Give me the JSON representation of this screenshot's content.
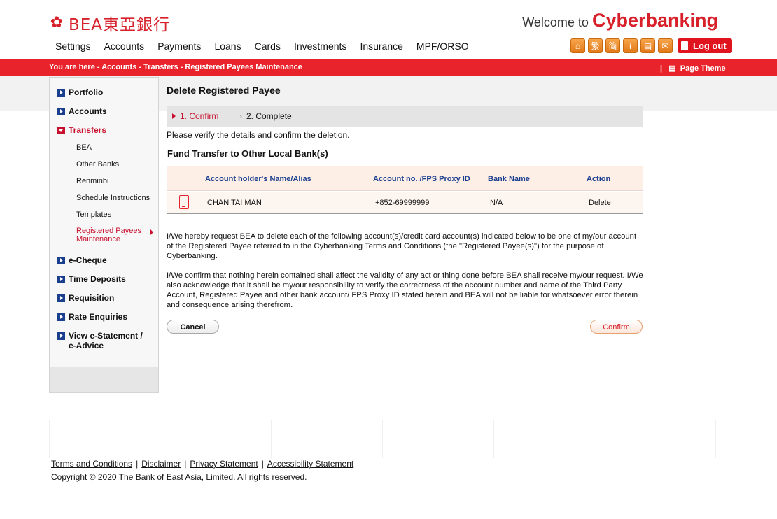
{
  "brand": {
    "logo_text": "BEA東亞銀行",
    "welcome_prefix": "Welcome to",
    "welcome_brand": "Cyberbanking"
  },
  "topnav": [
    "Settings",
    "Accounts",
    "Payments",
    "Loans",
    "Cards",
    "Investments",
    "Insurance",
    "MPF/ORSO"
  ],
  "tools": {
    "icons": [
      "home-icon",
      "traditional-chinese-icon",
      "simplified-chinese-icon",
      "info-icon",
      "print-icon",
      "mail-icon"
    ],
    "glyphs": [
      "⌂",
      "繁",
      "简",
      "i",
      "▤",
      "✉"
    ],
    "logout_label": "Log out"
  },
  "breadcrumb": "You are here - Accounts - Transfers - Registered Payees Maintenance",
  "page_theme": "Page Theme",
  "sidebar": {
    "menu": [
      "Portfolio",
      "Accounts",
      "Transfers",
      "e-Cheque",
      "Time Deposits",
      "Requisition",
      "Rate Enquiries",
      "View e-Statement / e-Advice"
    ],
    "transfers_sub": [
      "BEA",
      "Other Banks",
      "Renminbi",
      "Schedule Instructions",
      "Templates",
      "Registered Payees Maintenance"
    ]
  },
  "main": {
    "title": "Delete Registered Payee",
    "step1": "1. Confirm",
    "step2": "2. Complete",
    "note": "Please verify the details and confirm the deletion.",
    "section_title": "Fund Transfer to Other Local Bank(s)",
    "table": {
      "headers": [
        "Account holder's Name/Alias",
        "Account no. /FPS Proxy ID",
        "Bank Name",
        "Action"
      ],
      "row": [
        "CHAN TAI MAN",
        "+852-69999999",
        "N/A",
        "Delete"
      ]
    },
    "para1": "I/We hereby request BEA to delete each of the following account(s)/credit card account(s) indicated below to be one of my/our account of the Registered Payee referred to in the Cyberbanking Terms and Conditions (the \"Registered Payee(s)\") for the purpose of Cyberbanking.",
    "para2": "I/We confirm that nothing herein contained shall affect the validity of any act or thing done before BEA shall receive my/our request. I/We also acknowledge that it shall be my/our responsibility to verify the correctness of the account number and name of the Third Party Account, Registered Payee and other bank account/ FPS Proxy ID stated herein and BEA will not be liable for whatsoever error therein and consequence arising therefrom.",
    "cancel_label": "Cancel",
    "confirm_label": "Confirm"
  },
  "footer": {
    "links": [
      "Terms and Conditions",
      "Disclaimer",
      "Privacy Statement",
      "Accessibility Statement"
    ],
    "separator": "|",
    "copyright": "Copyright © 2020 The Bank of East Asia, Limited. All rights reserved."
  },
  "colors": {
    "brand_red": "#e8232b",
    "nav_blue": "#1b3f8f",
    "tool_orange": "#f7a44a"
  }
}
